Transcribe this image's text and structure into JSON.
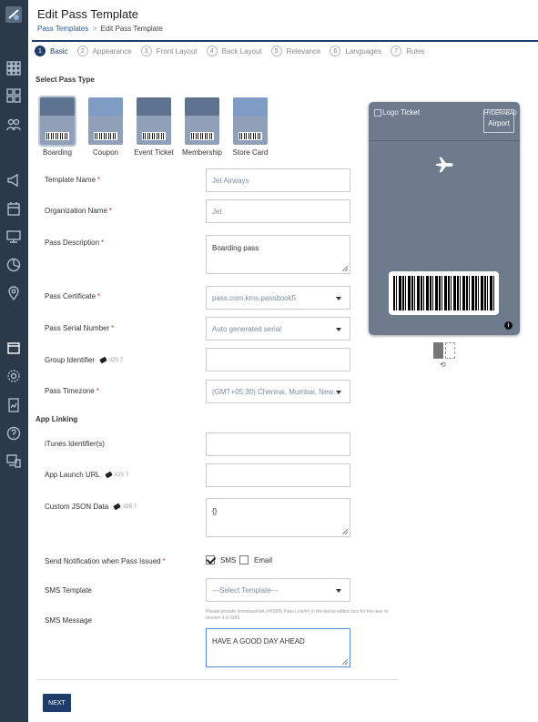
{
  "header": {
    "title": "Edit Pass Template"
  },
  "breadcrumb": {
    "root": "Pass Templates",
    "separator": ">",
    "current": "Edit Pass Template"
  },
  "steps": [
    {
      "num": "1",
      "label": "Basic"
    },
    {
      "num": "2",
      "label": "Appearance"
    },
    {
      "num": "3",
      "label": "Front Layout"
    },
    {
      "num": "4",
      "label": "Back Layout"
    },
    {
      "num": "5",
      "label": "Relevance"
    },
    {
      "num": "6",
      "label": "Languages"
    },
    {
      "num": "7",
      "label": "Rules"
    }
  ],
  "pass_type": {
    "heading": "Select Pass Type",
    "types": [
      "Boarding",
      "Coupon",
      "Event Ticket",
      "Membership",
      "Store Card"
    ],
    "selected": "Boarding"
  },
  "form": {
    "template_name": {
      "label": "Template Name",
      "value": "Jet Airways"
    },
    "organization_name": {
      "label": "Organization Name",
      "value": "Jet"
    },
    "pass_description": {
      "label": "Pass Description",
      "value": "Boarding pass"
    },
    "pass_certificate": {
      "label": "Pass Certificate",
      "value": "pass.com.kms.passbook5"
    },
    "pass_serial_number": {
      "label": "Pass Serial Number",
      "value": "Auto generated serial"
    },
    "group_identifier": {
      "label": "Group Identifier",
      "badge": "iOS 7",
      "value": ""
    },
    "pass_timezone": {
      "label": "Pass Timezone",
      "value": "(GMT+05:30) Chennai, Mumbai, New..."
    }
  },
  "app_linking": {
    "heading": "App Linking",
    "itunes_identifiers": {
      "label": "iTunes Identifier(s)",
      "value": ""
    },
    "app_launch_url": {
      "label": "App Launch URL",
      "badge": "iOS 7",
      "value": ""
    },
    "custom_json_data": {
      "label": "Custom JSON Data",
      "badge": "iOS 7",
      "value": "{}"
    },
    "send_notification": {
      "label": "Send Notification when Pass Issued",
      "sms": "SMS",
      "email": "Email",
      "sms_checked": true,
      "email_checked": false
    },
    "sms_template": {
      "label": "SMS Template",
      "value": "---Select Template---"
    },
    "sms_message": {
      "label": "SMS Message",
      "hint": "Please provide download link (##SMS Pass Link##) in the below edition box for the user to receive it in SMS",
      "value": "HAVE A GOOD DAY AHEAD"
    }
  },
  "preview": {
    "logo_alt": "Logo",
    "ticket_label": "Ticket",
    "destination_code": "HYDERABAD",
    "destination_label": "Airport",
    "info_icon": "i"
  },
  "actions": {
    "next": "NEXT"
  },
  "colors": {
    "sidebar": "#2b3a4a",
    "accent": "#1f3d6b",
    "preview_bg": "#6d7b8d",
    "required": "#c0392b"
  }
}
